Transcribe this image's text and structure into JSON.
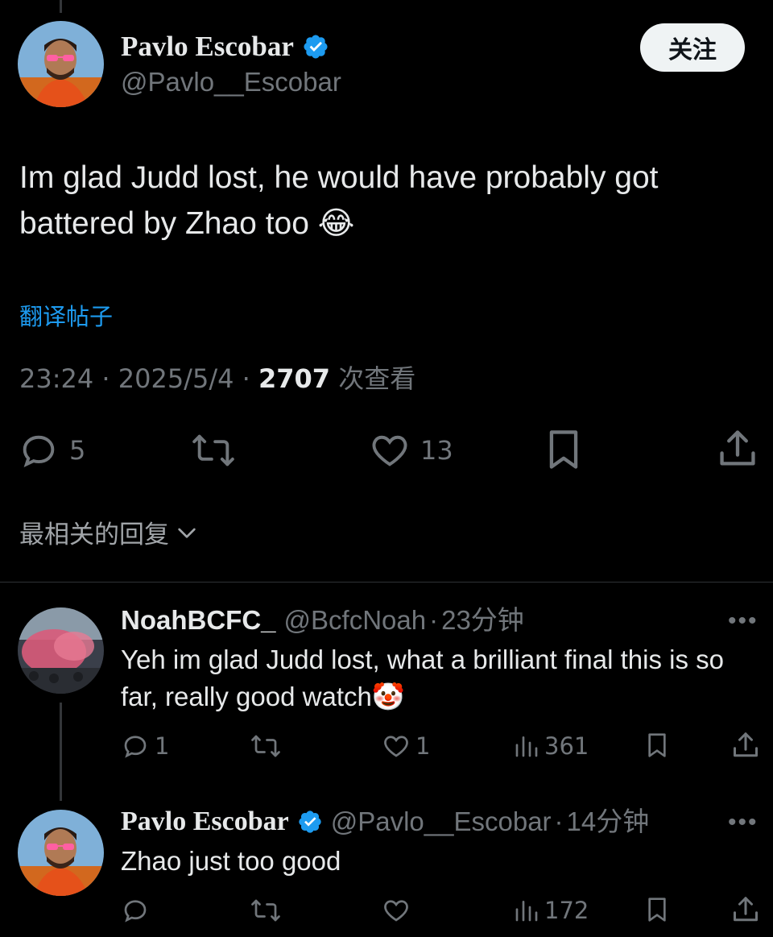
{
  "main_tweet": {
    "author_name": "Pavlo Escobar",
    "author_handle": "@Pavlo__Escobar",
    "follow_label": "关注",
    "text": "Im glad Judd lost,  he would have probably got battered by Zhao too 😂",
    "translate_label": "翻译帖子",
    "time": "23:24",
    "date": "2025/5/4",
    "views_count": "2707",
    "views_label": "次查看",
    "separator": "·",
    "actions": {
      "replies": "5",
      "retweets": "",
      "likes": "13"
    }
  },
  "sort_label": "最相关的回复",
  "replies": [
    {
      "author_name": "NoahBCFC_",
      "author_handle": "@BcfcNoah",
      "time_ago": "23分钟",
      "text": "Yeh im glad Judd lost, what a brilliant final this is so far, really good watch🤡",
      "actions": {
        "replies": "1",
        "retweets": "",
        "likes": "1",
        "views": "361"
      },
      "more": "•••"
    },
    {
      "author_name": "Pavlo Escobar",
      "author_handle": "@Pavlo__Escobar",
      "time_ago": "14分钟",
      "text": "Zhao just too good",
      "actions": {
        "replies": "",
        "retweets": "",
        "likes": "",
        "views": "172"
      },
      "more": "•••"
    }
  ],
  "colors": {
    "background": "#000000",
    "text": "#e7e9ea",
    "muted": "#71767b",
    "accent": "#1d9bf0",
    "verified": "#1d9bf0"
  }
}
